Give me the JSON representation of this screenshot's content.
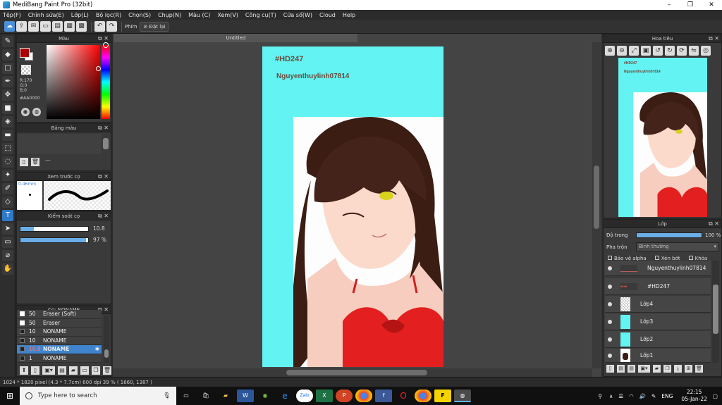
{
  "window": {
    "title": "MediBang Paint Pro (32bit)",
    "controls": [
      "–",
      "❐",
      "✕"
    ]
  },
  "menu": [
    "Tệp(F)",
    "Chỉnh sửa(E)",
    "Lớp(L)",
    "Bộ lọc(R)",
    "Chọn(S)",
    "Chụp(N)",
    "Màu (C)",
    "Xem(V)",
    "Công cụ(T)",
    "Cửa sổ(W)",
    "Cloud",
    "Help"
  ],
  "toolbar": {
    "key_label": "Phím",
    "reset_label": "Đặt lại"
  },
  "color_panel": {
    "title": "Màu",
    "r": "R:170",
    "g": "G:0",
    "b": "B:0",
    "hex": "#AA0000",
    "fg_color": "#aa0000"
  },
  "palette_panel": {
    "title": "Bảng màu",
    "dash": "---"
  },
  "brush_preview": {
    "title": "Xem trước cọ",
    "size": "0.46mm"
  },
  "brush_control": {
    "title": "Kiểm soát cọ",
    "size_value": "10.8",
    "opacity_value": "97 %",
    "size_fraction": 0.2,
    "opacity_fraction": 0.97
  },
  "brush_list": {
    "title": "Cọ: NONAME",
    "rows": [
      {
        "size": "50",
        "name": "Eraser (Soft)"
      },
      {
        "size": "50",
        "name": "Eraser"
      },
      {
        "size": "10",
        "name": "NONAME"
      },
      {
        "size": "10",
        "name": "NONAME"
      },
      {
        "size": "10.8",
        "name": "NONAME"
      },
      {
        "size": "1",
        "name": "NONAME"
      }
    ]
  },
  "canvas": {
    "tab_title": "Untitled",
    "text1": "#HD247",
    "text2": "Nguyenthuylinh07814"
  },
  "navigator": {
    "title": "Hoa tiêu",
    "text1": "#HD247",
    "text2": "Nguyenthuylinh07814"
  },
  "layer_panel": {
    "title": "Lớp",
    "opacity_label": "Độ trong",
    "opacity_value": "100 %",
    "blend_label": "Pha trộn",
    "blend_value": "Bình thường",
    "checks": [
      "Bảo vệ alpha",
      "Xén bớt",
      "Khóa"
    ],
    "layers": [
      "Nguyenthuylinh07814",
      "#HD247",
      "Lớp4",
      "Lớp3",
      "Lớp2",
      "Lớp1"
    ]
  },
  "status": {
    "text": "1024 * 1820 pixel   (4.3 * 7.7cm)  600 dpi  39 %  ( 1660, 1387 )"
  },
  "taskbar": {
    "search_placeholder": "Type here to search",
    "lang": "ENG",
    "time": "22:15",
    "date": "05-Jan-22"
  }
}
